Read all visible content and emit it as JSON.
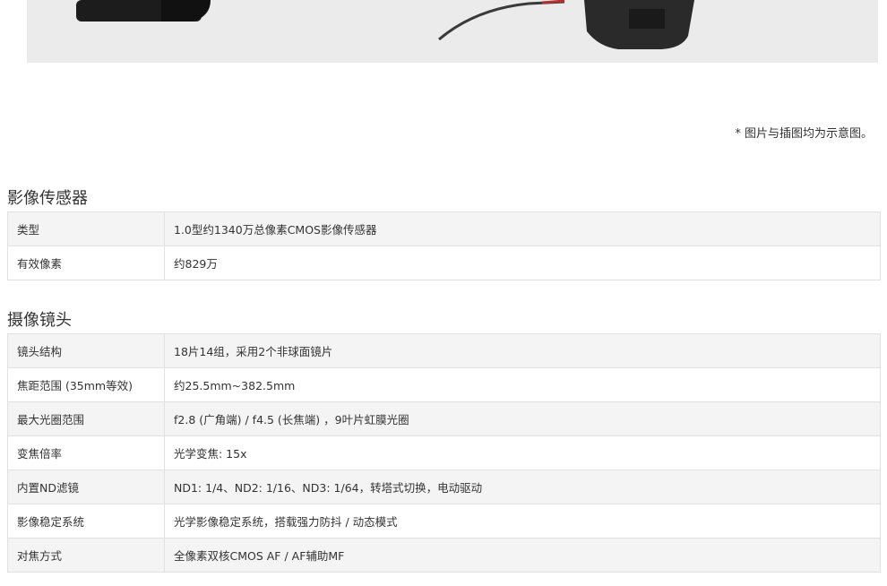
{
  "image_note": "* 图片与插图均为示意图。",
  "sections": [
    {
      "title": "影像传感器",
      "rows": [
        {
          "label": "类型",
          "value": "1.0型约1340万总像素CMOS影像传感器"
        },
        {
          "label": "有效像素",
          "value": "约829万"
        }
      ]
    },
    {
      "title": "摄像镜头",
      "rows": [
        {
          "label": "镜头结构",
          "value": "18片14组，采用2个非球面镜片"
        },
        {
          "label": "焦距范围 (35mm等效)",
          "value": "约25.5mm~382.5mm"
        },
        {
          "label": "最大光圈范围",
          "value": "f2.8 (广角端) / f4.5 (长焦端) ，9叶片虹膜光圈"
        },
        {
          "label": "变焦倍率",
          "value": "光学变焦: 15x"
        },
        {
          "label": "内置ND滤镜",
          "value": "ND1: 1/4、ND2: 1/16、ND3: 1/64，转塔式切换，电动驱动"
        },
        {
          "label": "影像稳定系统",
          "value": "光学影像稳定系统，搭载强力防抖 / 动态模式"
        },
        {
          "label": "对焦方式",
          "value": "全像素双核CMOS AF / AF辅助MF"
        }
      ]
    }
  ]
}
